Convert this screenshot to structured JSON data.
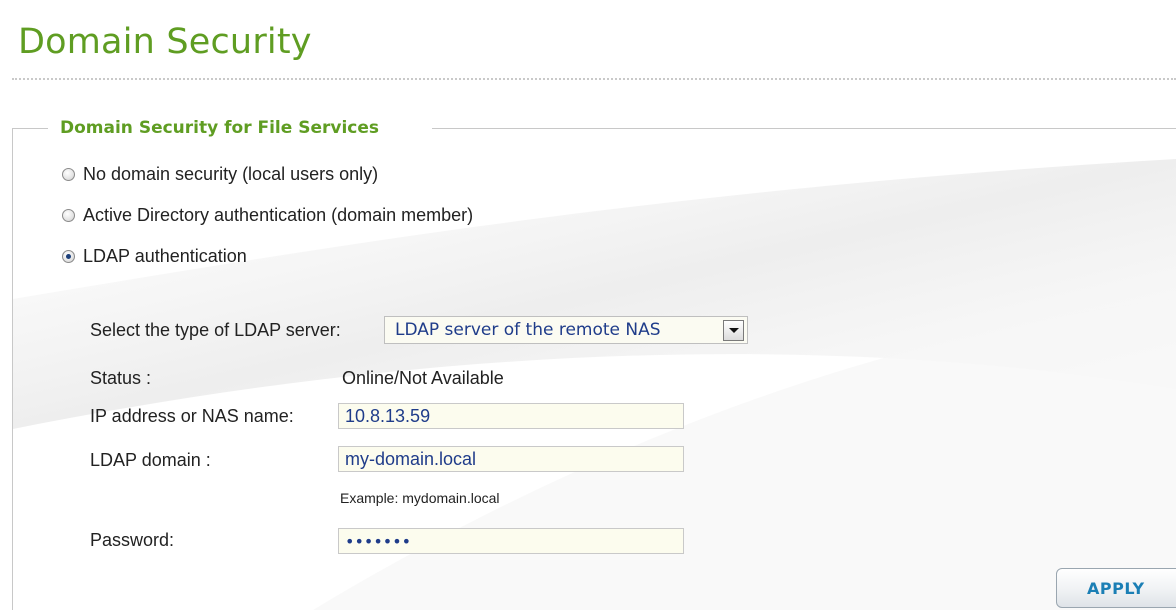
{
  "page": {
    "title": "Domain Security"
  },
  "section": {
    "legend": "Domain Security for File Services",
    "options": [
      {
        "label": "No domain security (local users only)",
        "checked": false
      },
      {
        "label": "Active Directory authentication (domain member)",
        "checked": false
      },
      {
        "label": "LDAP authentication",
        "checked": true
      }
    ]
  },
  "ldap": {
    "server_type_label": "Select the type of LDAP server:",
    "server_type_value": "LDAP server of the remote NAS",
    "status_label": "Status :",
    "status_value": "Online/Not Available",
    "ip_label": "IP address or NAS name:",
    "ip_value": "10.8.13.59",
    "domain_label": "LDAP domain :",
    "domain_value": "my-domain.local",
    "domain_hint": "Example: mydomain.local",
    "password_label": "Password:",
    "password_value": "abcdefg"
  },
  "actions": {
    "apply_label": "APPLY"
  },
  "colors": {
    "accent_green": "#5f9d22",
    "value_blue": "#1f3c8a",
    "button_text": "#1b7fb5"
  }
}
